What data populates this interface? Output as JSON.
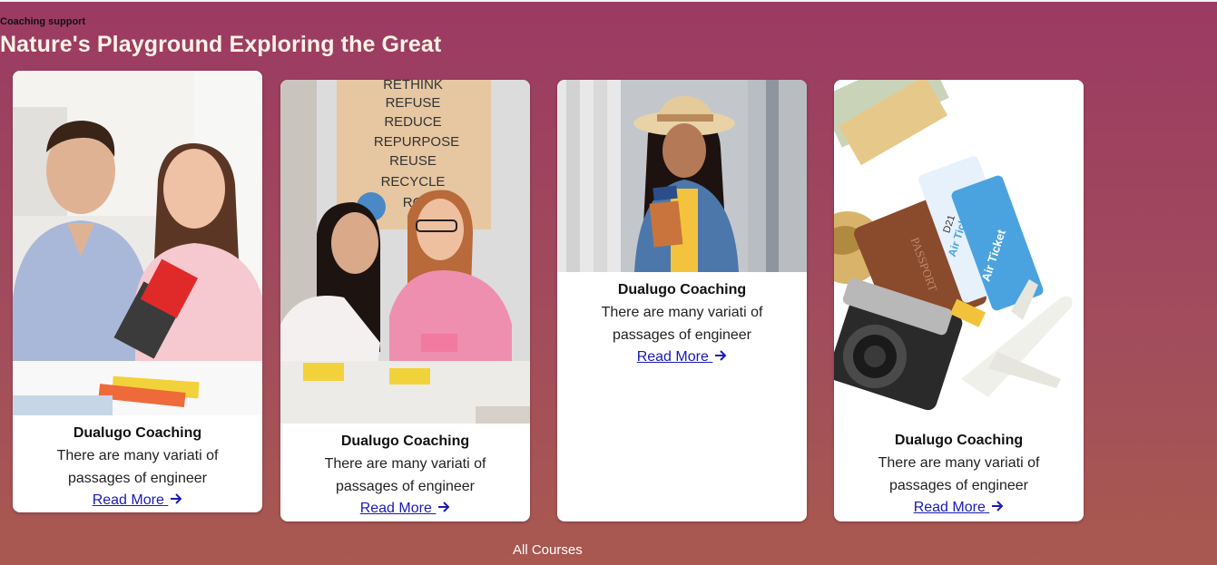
{
  "section": {
    "eyebrow": "Coaching support",
    "headline": "Nature's Playground Exploring the Great",
    "all_courses_label": "All Courses"
  },
  "cards": [
    {
      "title": "Dualugo Coaching",
      "text": "There are many variati of passages of engineer",
      "link": "Read More"
    },
    {
      "title": "Dualugo Coaching",
      "text": "There are many variati of passages of engineer",
      "link": "Read More"
    },
    {
      "title": "Dualugo Coaching",
      "text": "There are many variati of passages of engineer",
      "link": "Read More"
    },
    {
      "title": "Dualugo Coaching",
      "text": "There are many variati of passages of engineer",
      "link": "Read More"
    }
  ],
  "poster_words": [
    "RETHINK",
    "REFUSE",
    "REDUCE",
    "REPURPOSE",
    "REUSE",
    "RECYCLE",
    "RO"
  ],
  "ticket_labels": [
    "Air Ticket",
    "Air Tick",
    "PASSPORT",
    "D21"
  ],
  "colors": {
    "link": "#1a1ab8",
    "headline": "#fff3e6"
  }
}
